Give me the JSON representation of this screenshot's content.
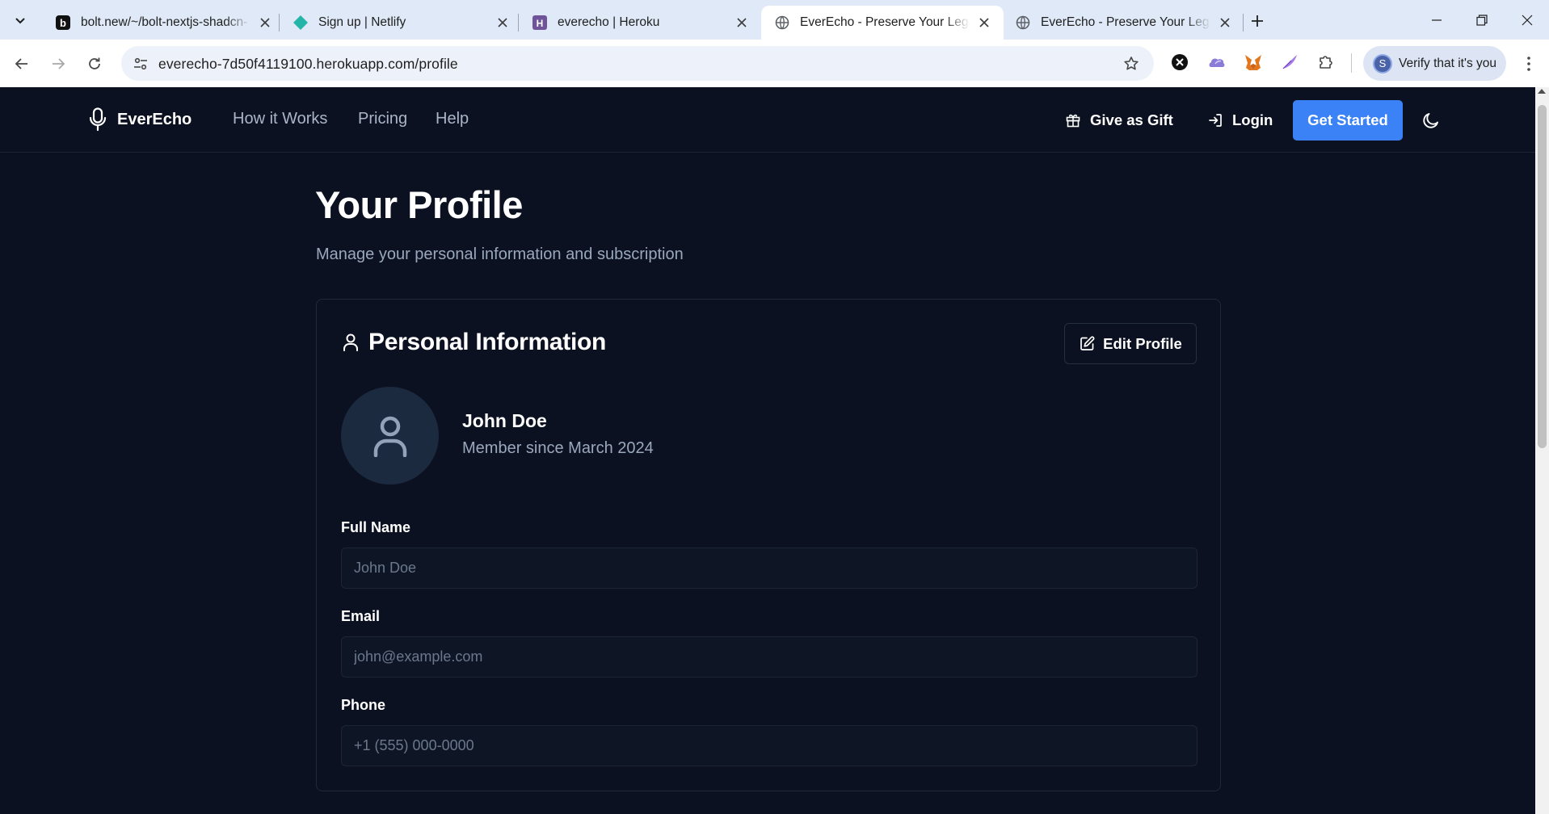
{
  "browser": {
    "tabs": [
      {
        "title": "bolt.new/~/bolt-nextjs-shadcn-",
        "favicon": "bolt-icon"
      },
      {
        "title": "Sign up | Netlify",
        "favicon": "netlify-icon"
      },
      {
        "title": "everecho | Heroku",
        "favicon": "heroku-icon"
      },
      {
        "title": "EverEcho - Preserve Your Legacy",
        "favicon": "globe-icon",
        "active": true
      },
      {
        "title": "EverEcho - Preserve Your Legacy",
        "favicon": "globe-icon"
      }
    ],
    "url": "everecho-7d50f4119100.herokuapp.com/profile",
    "verify_label": "Verify that it's you",
    "profile_initial": "S"
  },
  "site": {
    "brand": "EverEcho",
    "nav": [
      "How it Works",
      "Pricing",
      "Help"
    ],
    "gift_label": "Give as Gift",
    "login_label": "Login",
    "cta_label": "Get Started"
  },
  "profile": {
    "title": "Your Profile",
    "subtitle": "Manage your personal information and subscription",
    "card_title": "Personal Information",
    "edit_label": "Edit Profile",
    "user_name": "John Doe",
    "member_since": "Member since March 2024",
    "fields": [
      {
        "label": "Full Name",
        "placeholder": "John Doe"
      },
      {
        "label": "Email",
        "placeholder": "john@example.com"
      },
      {
        "label": "Phone",
        "placeholder": "+1 (555) 000-0000"
      }
    ]
  },
  "colors": {
    "page_bg": "#0b1120",
    "accent": "#3b82f6",
    "muted_text": "#9aa8bc"
  }
}
